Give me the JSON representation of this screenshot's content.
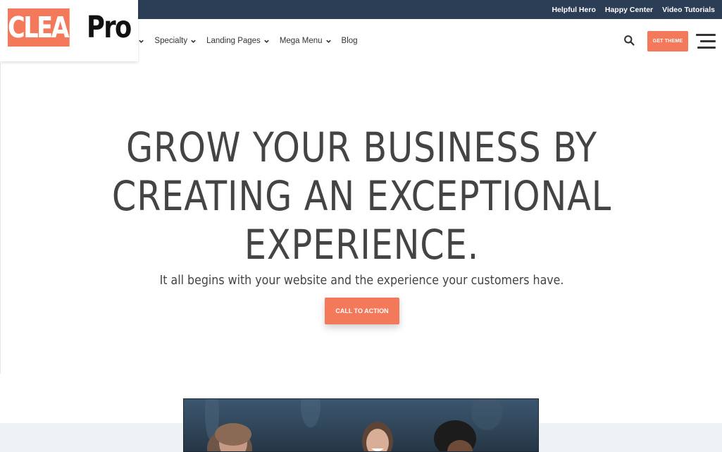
{
  "topbar": {
    "links": [
      "Helpful Hero",
      "Happy Center",
      "Video Tutorials"
    ]
  },
  "logo": {
    "part1": "CLEAN",
    "part2": "Pro",
    "accent_color": "#f4785a"
  },
  "nav": {
    "items": [
      {
        "label": "e",
        "has_dropdown": true
      },
      {
        "label": "Specialty",
        "has_dropdown": true
      },
      {
        "label": "Landing Pages",
        "has_dropdown": true
      },
      {
        "label": "Mega Menu",
        "has_dropdown": true
      },
      {
        "label": "Blog",
        "has_dropdown": false
      }
    ],
    "search_icon": "search-icon",
    "cta_label": "GET THEME",
    "menu_icon": "hamburger-icon"
  },
  "hero": {
    "title_line1": "GROW YOUR BUSINESS BY",
    "title_line2": "CREATING AN EXCEPTIONAL",
    "title_line3": "EXPERIENCE.",
    "subtitle": "It all begins with your website and the experience your customers have.",
    "cta_label": "CALL TO ACTION"
  },
  "colors": {
    "topbar_bg": "#2c3e56",
    "accent": "#f4785a",
    "text": "#444444"
  }
}
